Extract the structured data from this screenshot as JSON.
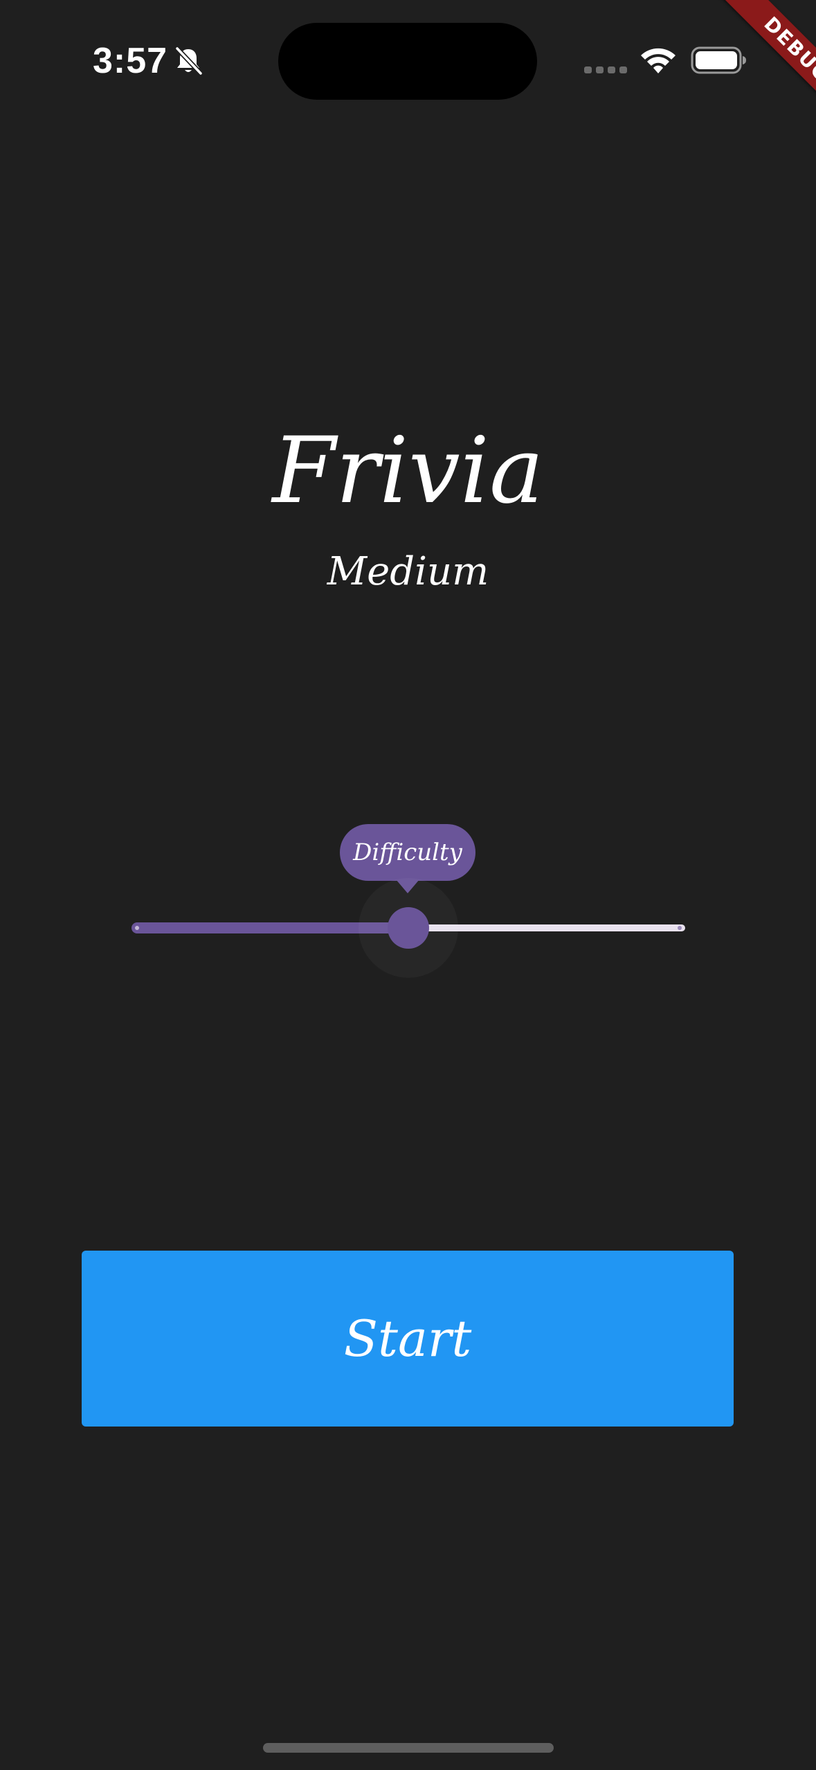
{
  "status_bar": {
    "time": "3:57",
    "icons": {
      "silent": "bell-off-icon",
      "signal": "cellular-signal-icon",
      "wifi": "wifi-icon",
      "battery": "battery-icon"
    }
  },
  "debug_banner": {
    "label": "DEBUG",
    "color": "#8b1a1a"
  },
  "app": {
    "title": "Frivia",
    "difficulty_text": "Medium"
  },
  "slider": {
    "tooltip": "Difficulty",
    "min": 0,
    "max": 2,
    "value": 1,
    "divisions": 2,
    "active_color": "#6a5599",
    "inactive_color": "#e9e2ef"
  },
  "start_button": {
    "label": "Start",
    "color": "#2196f3"
  },
  "colors": {
    "background": "#1f1f1f",
    "text": "#ffffff"
  }
}
